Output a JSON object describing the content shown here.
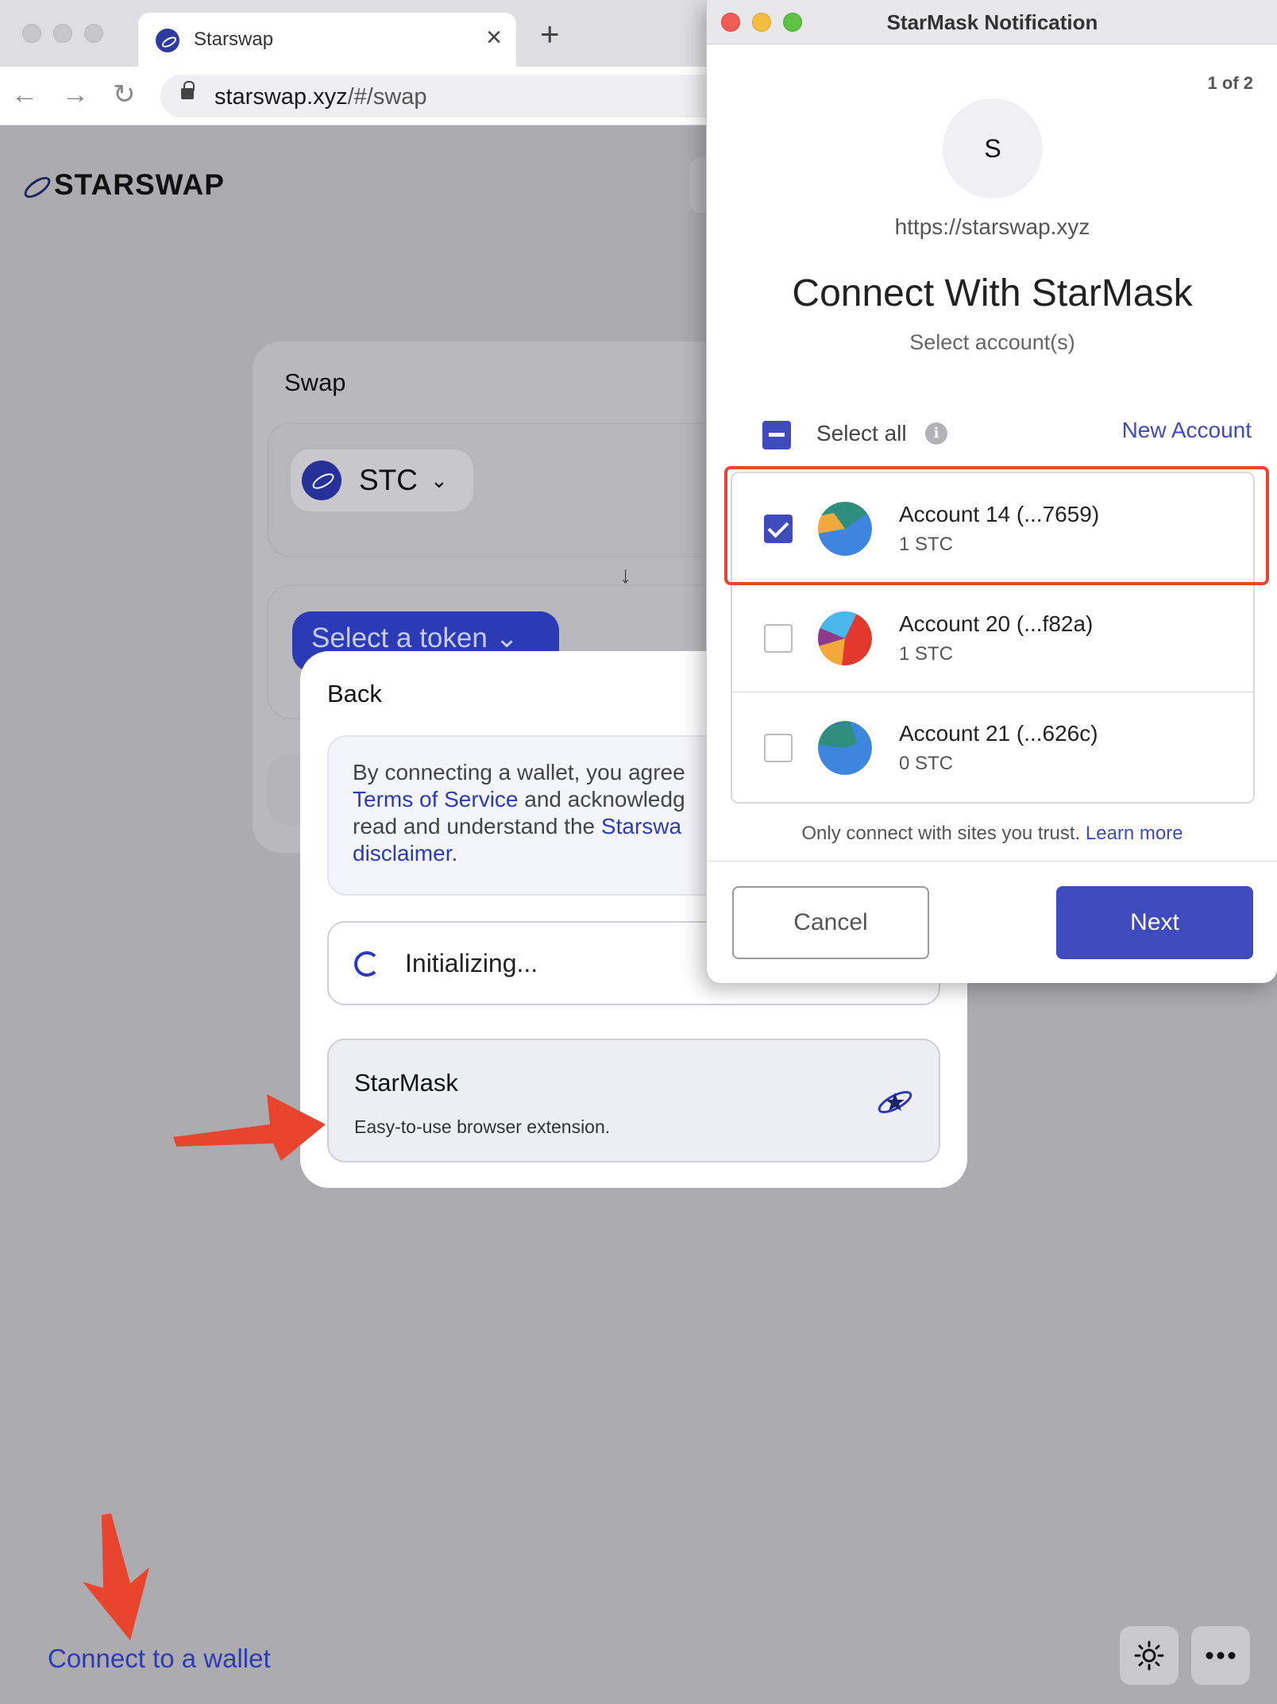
{
  "browser": {
    "tab_title": "Starswap",
    "tab_close": "×",
    "new_tab": "+",
    "url_host": "starswap.xyz",
    "url_path": "/#/swap",
    "back": "←",
    "forward": "→",
    "reload": "↻"
  },
  "page": {
    "logo_text": "STARSWAP",
    "swap_label": "Swap",
    "token": "STC",
    "select_token": "Select a token",
    "connect_link": "Connect to a wallet"
  },
  "wallet_modal": {
    "back": "Back",
    "terms_pre": "By connecting a wallet, you agree",
    "terms_link1": "Terms of Service",
    "terms_mid": " and acknowledg",
    "terms_line3_pre": "read and understand the ",
    "terms_link2": "Starswa",
    "terms_link3": "disclaimer",
    "terms_end": ".",
    "initializing": "Initializing...",
    "starmask_name": "StarMask",
    "starmask_desc": "Easy-to-use browser extension."
  },
  "popup": {
    "title": "StarMask Notification",
    "count": "1 of 2",
    "avatar_letter": "S",
    "origin": "https://starswap.xyz",
    "heading": "Connect With StarMask",
    "subheading": "Select account(s)",
    "select_all": "Select all",
    "new_account": "New Account",
    "accounts": [
      {
        "name": "Account 14 (...7659)",
        "balance": "1 STC",
        "checked": true
      },
      {
        "name": "Account 20 (...f82a)",
        "balance": "1 STC",
        "checked": false
      },
      {
        "name": "Account 21 (...626c)",
        "balance": "0 STC",
        "checked": false
      }
    ],
    "trust_text": "Only connect with sites you trust.",
    "learn_more": "Learn more",
    "cancel": "Cancel",
    "next": "Next"
  },
  "colors": {
    "accent": "#3f4bbd",
    "brand_blue": "#2b3bb5",
    "highlight_red": "#e8442e"
  }
}
